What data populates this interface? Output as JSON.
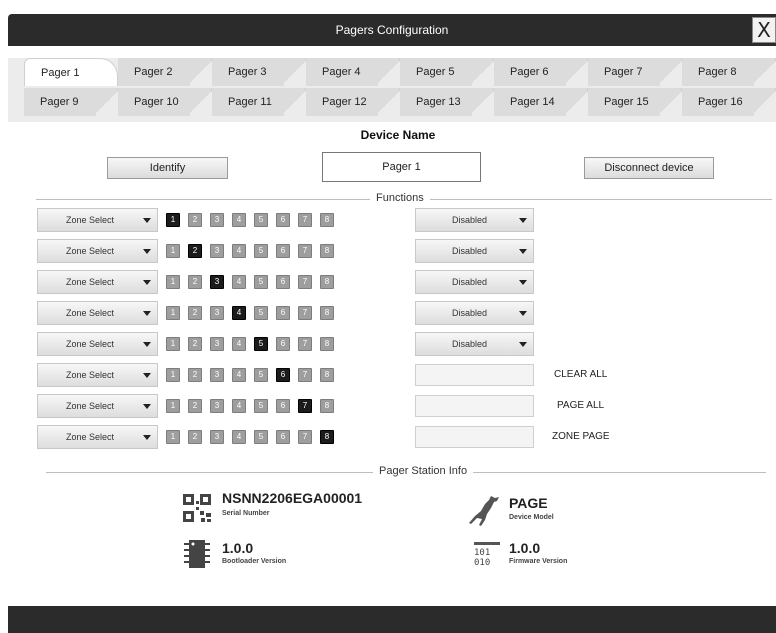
{
  "window": {
    "title": "Pagers Configuration",
    "close_label": "X"
  },
  "tabs_row1": [
    "Pager 1",
    "Pager 2",
    "Pager 3",
    "Pager 4",
    "Pager 5",
    "Pager 6",
    "Pager 7",
    "Pager 8"
  ],
  "tabs_row2": [
    "Pager 9",
    "Pager 10",
    "Pager 11",
    "Pager 12",
    "Pager 13",
    "Pager 14",
    "Pager 15",
    "Pager 16"
  ],
  "active_tab": "Pager 1",
  "device": {
    "heading": "Device Name",
    "identify_label": "Identify",
    "name_value": "Pager 1",
    "disconnect_label": "Disconnect device"
  },
  "functions": {
    "title": "Functions",
    "rows": [
      {
        "select": "Zone Select",
        "zones": [
          "1",
          "2",
          "3",
          "4",
          "5",
          "6",
          "7",
          "8"
        ],
        "active_zone": 1,
        "action_select": "Disabled",
        "action_label": ""
      },
      {
        "select": "Zone Select",
        "zones": [
          "1",
          "2",
          "3",
          "4",
          "5",
          "6",
          "7",
          "8"
        ],
        "active_zone": 2,
        "action_select": "Disabled",
        "action_label": ""
      },
      {
        "select": "Zone Select",
        "zones": [
          "1",
          "2",
          "3",
          "4",
          "5",
          "6",
          "7",
          "8"
        ],
        "active_zone": 3,
        "action_select": "Disabled",
        "action_label": ""
      },
      {
        "select": "Zone Select",
        "zones": [
          "1",
          "2",
          "3",
          "4",
          "5",
          "6",
          "7",
          "8"
        ],
        "active_zone": 4,
        "action_select": "Disabled",
        "action_label": ""
      },
      {
        "select": "Zone Select",
        "zones": [
          "1",
          "2",
          "3",
          "4",
          "5",
          "6",
          "7",
          "8"
        ],
        "active_zone": 5,
        "action_select": "Disabled",
        "action_label": ""
      },
      {
        "select": "Zone Select",
        "zones": [
          "1",
          "2",
          "3",
          "4",
          "5",
          "6",
          "7",
          "8"
        ],
        "active_zone": 6,
        "action_select": "",
        "action_label": "CLEAR ALL"
      },
      {
        "select": "Zone Select",
        "zones": [
          "1",
          "2",
          "3",
          "4",
          "5",
          "6",
          "7",
          "8"
        ],
        "active_zone": 7,
        "action_select": "",
        "action_label": "PAGE ALL"
      },
      {
        "select": "Zone Select",
        "zones": [
          "1",
          "2",
          "3",
          "4",
          "5",
          "6",
          "7",
          "8"
        ],
        "active_zone": 8,
        "action_select": "",
        "action_label": "ZONE PAGE"
      }
    ]
  },
  "station_info": {
    "title": "Pager Station Info",
    "serial_value": "NSNN2206EGA00001",
    "serial_label": "Serial Number",
    "model_value": "PAGE",
    "model_label": "Device Model",
    "bootloader_value": "1.0.0",
    "bootloader_label": "Bootloader Version",
    "firmware_value": "1.0.0",
    "firmware_label": "Firmware Version"
  },
  "icons": {
    "serial": "qr-code-icon",
    "model": "kangaroo-icon",
    "bootloader": "chip-icon",
    "firmware": "binary-icon"
  },
  "colors": {
    "titlebar": "#2b2b2b",
    "zone_inactive": "#9e9e9e",
    "zone_active": "#1c1c1c"
  }
}
